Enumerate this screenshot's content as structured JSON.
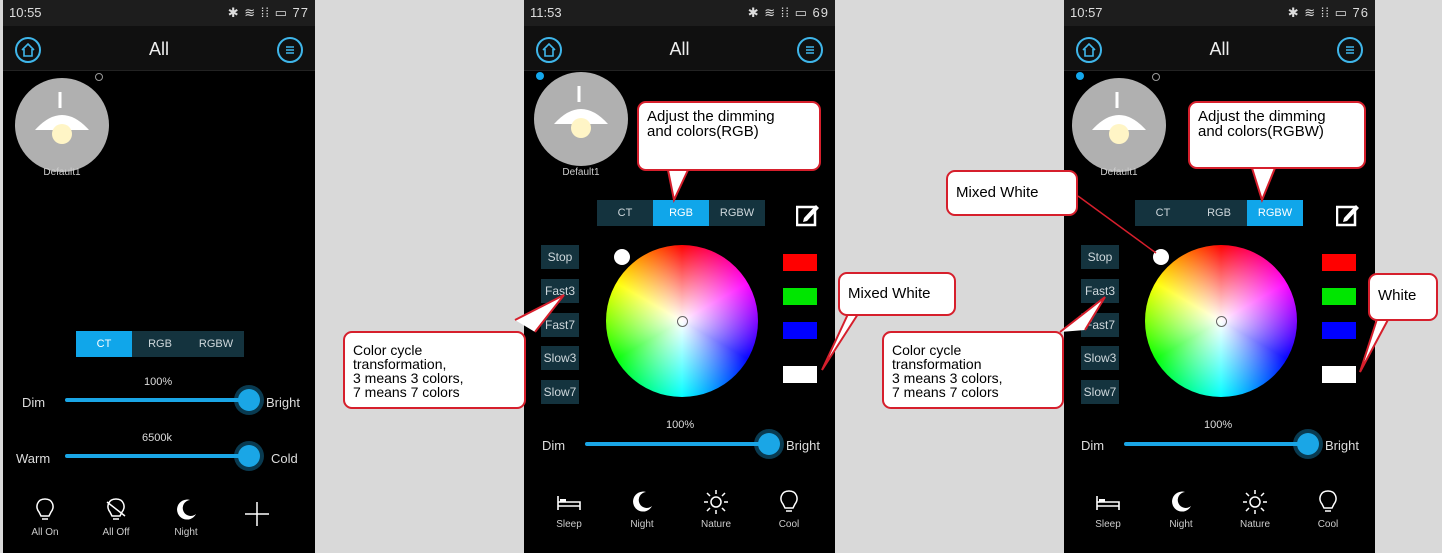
{
  "common": {
    "title": "All",
    "lamp_label": "Default1",
    "tabs": [
      "CT",
      "RGB",
      "RGBW"
    ],
    "dim_label": "Dim",
    "bright_label": "Bright"
  },
  "screen1": {
    "time": "10:55",
    "battery": "77",
    "active_tab": "CT",
    "brightness_value": "100%",
    "brightness_fraction": 1.0,
    "temp_value": "6500k",
    "temp_fraction": 1.0,
    "warm_label": "Warm",
    "cold_label": "Cold",
    "bottom": [
      {
        "label": "All On",
        "icon": "bulb-on-icon"
      },
      {
        "label": "All Off",
        "icon": "bulb-off-icon"
      },
      {
        "label": "Night",
        "icon": "moon-icon"
      },
      {
        "label": "",
        "icon": "plus-icon"
      }
    ]
  },
  "screen2": {
    "time": "11:53",
    "battery": "69",
    "active_tab": "RGB",
    "cycle_buttons": [
      "Stop",
      "Fast3",
      "Fast7",
      "Slow3",
      "Slow7"
    ],
    "swatches": [
      "#ff0000",
      "#00e600",
      "#0000ff",
      "#ffffff"
    ],
    "brightness_value": "100%",
    "brightness_fraction": 1.0,
    "callout_tab_line1": "Adjust the dimming",
    "callout_tab_line2": "and colors(RGB)",
    "callout_white": "Mixed White",
    "callout_cycle_line1": "Color cycle transformation,",
    "callout_cycle_line2": "3 means 3 colors,",
    "callout_cycle_line3": "7 means 7 colors",
    "bottom": [
      {
        "label": "Sleep",
        "icon": "bed-icon"
      },
      {
        "label": "Night",
        "icon": "moon-icon"
      },
      {
        "label": "Nature",
        "icon": "sun-icon"
      },
      {
        "label": "Cool",
        "icon": "bulb-icon"
      }
    ]
  },
  "screen3": {
    "time": "10:57",
    "battery": "76",
    "active_tab": "RGBW",
    "cycle_buttons": [
      "Stop",
      "Fast3",
      "Fast7",
      "Slow3",
      "Slow7"
    ],
    "swatches": [
      "#ff0000",
      "#00e600",
      "#0000ff",
      "#ffffff"
    ],
    "brightness_value": "100%",
    "brightness_fraction": 1.0,
    "callout_tab_line1": "Adjust the dimming",
    "callout_tab_line2": "and colors(RGBW)",
    "callout_mixed": "Mixed White",
    "callout_white": "White",
    "callout_cycle_line1": "Color cycle transformation",
    "callout_cycle_line2": "3 means 3 colors,",
    "callout_cycle_line3": "7 means 7 colors",
    "bottom": [
      {
        "label": "Sleep",
        "icon": "bed-icon"
      },
      {
        "label": "Night",
        "icon": "moon-icon"
      },
      {
        "label": "Nature",
        "icon": "sun-icon"
      },
      {
        "label": "Cool",
        "icon": "bulb-icon"
      }
    ]
  }
}
